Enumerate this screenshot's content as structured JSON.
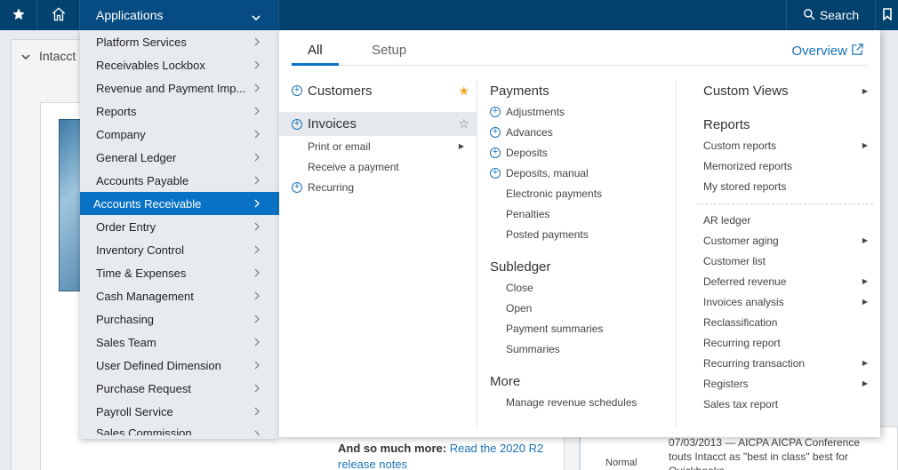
{
  "topbar": {
    "applications_label": "Applications",
    "search_label": "Search"
  },
  "background": {
    "header_label": "Intacct",
    "more_text": "And so much more:",
    "more_link": "Read the 2020 R2 release notes",
    "normal_label": "Normal",
    "news_text": "07/03/2013 — AICPA AICPA Conference touts Intacct as \"best in class\" best for Quickbooks"
  },
  "app_menu": [
    {
      "label": "Platform Services"
    },
    {
      "label": "Receivables Lockbox"
    },
    {
      "label": "Revenue and Payment Imp..."
    },
    {
      "label": "Reports"
    },
    {
      "label": "Company"
    },
    {
      "label": "General Ledger"
    },
    {
      "label": "Accounts Payable"
    },
    {
      "label": "Accounts Receivable",
      "active": true
    },
    {
      "label": "Order Entry"
    },
    {
      "label": "Inventory Control"
    },
    {
      "label": "Time & Expenses"
    },
    {
      "label": "Cash Management"
    },
    {
      "label": "Purchasing"
    },
    {
      "label": "Sales Team"
    },
    {
      "label": "User Defined Dimension"
    },
    {
      "label": "Purchase Request"
    },
    {
      "label": "Payroll Service"
    },
    {
      "label": "Sales Commission"
    }
  ],
  "flyout": {
    "tabs": [
      "All",
      "Setup"
    ],
    "overview_label": "Overview",
    "col1": {
      "customers": "Customers",
      "invoices": "Invoices",
      "print_or_email": "Print or email",
      "receive_payment": "Receive a payment",
      "recurring": "Recurring"
    },
    "col2": {
      "payments_header": "Payments",
      "payments": [
        "Adjustments",
        "Advances",
        "Deposits",
        "Deposits, manual",
        "Electronic payments",
        "Penalties",
        "Posted payments"
      ],
      "subledger_header": "Subledger",
      "subledger": [
        "Close",
        "Open",
        "Payment summaries",
        "Summaries"
      ],
      "more_header": "More",
      "more": [
        "Manage revenue schedules"
      ]
    },
    "col3": {
      "custom_views": "Custom Views",
      "reports_header": "Reports",
      "reports": [
        "Custom reports",
        "Memorized reports",
        "My stored reports"
      ],
      "more_reports": [
        "AR ledger",
        "Customer aging",
        "Customer list",
        "Deferred revenue",
        "Invoices analysis",
        "Reclassification",
        "Recurring report",
        "Recurring transaction",
        "Registers",
        "Sales tax report"
      ]
    }
  },
  "colors": {
    "topbar": "#03416f",
    "accent": "#0a72c4",
    "link": "#1a73b7",
    "favorite": "#f5a623"
  }
}
